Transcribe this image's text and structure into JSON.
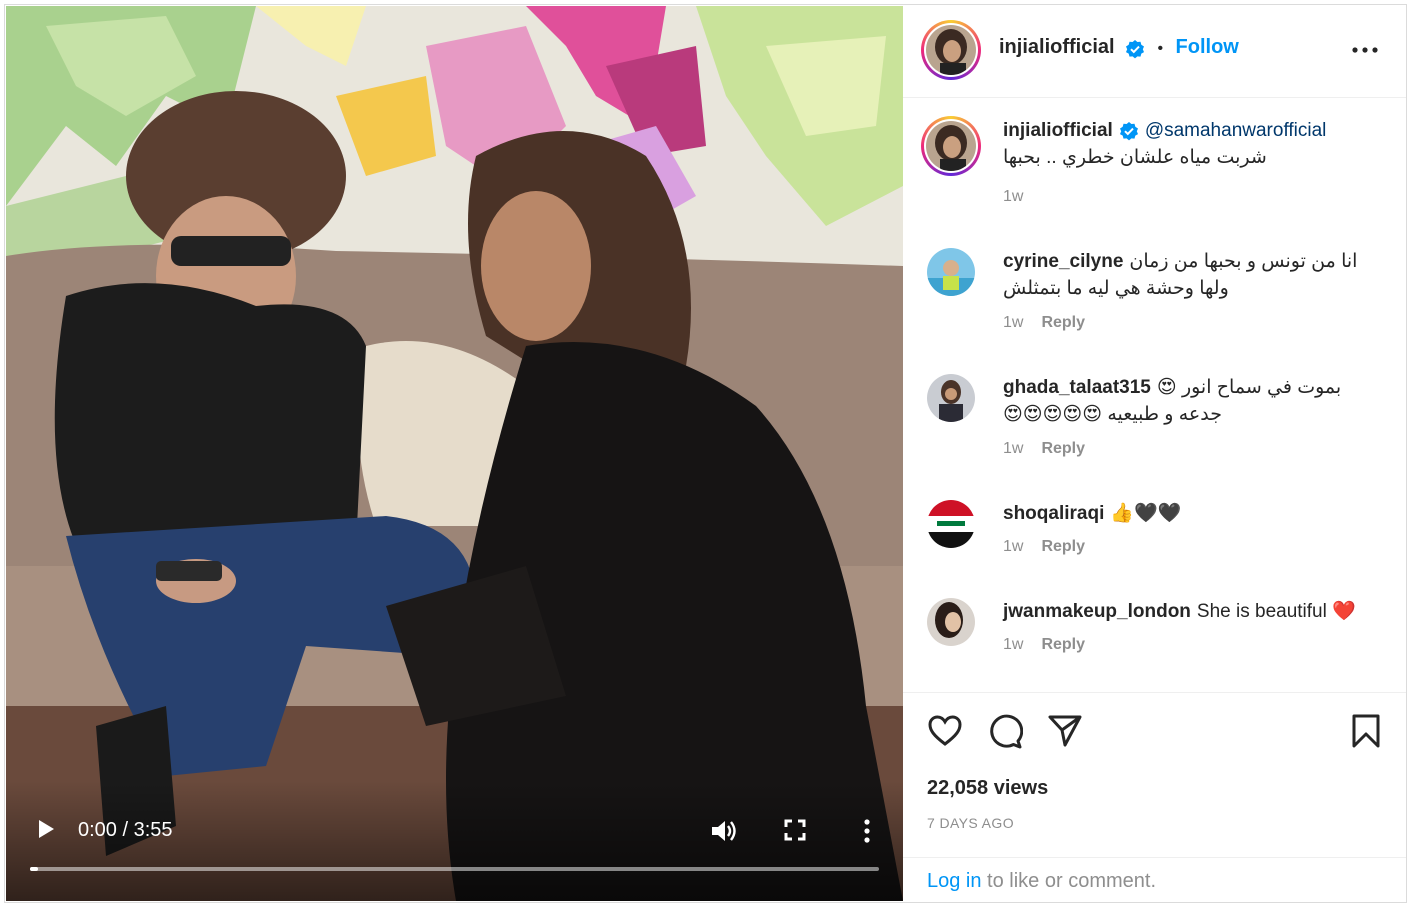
{
  "video": {
    "time_display": "0:00 / 3:55",
    "progress": 0.0
  },
  "post": {
    "author": "injialiofficial",
    "follow_label": "Follow",
    "separator": "•"
  },
  "caption": {
    "username": "injialiofficial",
    "mention": "@samahanwarofficial",
    "text": "شربت مياه علشان خطري .. بحبها",
    "time": "1w"
  },
  "comments": [
    {
      "username": "cyrine_cilyne",
      "text": "انا من تونس و بحبها من زمان ولها وحشة هي ليه ما بتمثلش",
      "time": "1w",
      "reply_label": "Reply"
    },
    {
      "username": "ghada_talaat315",
      "text": "بموت في سماح انور 😍 جدعه و طبيعيه 😍😍😍😍😍",
      "time": "1w",
      "reply_label": "Reply"
    },
    {
      "username": "shoqaliraqi",
      "text": "👍🖤🖤",
      "time": "1w",
      "reply_label": "Reply"
    },
    {
      "username": "jwanmakeup_london",
      "text": "She is beautiful",
      "text_emoji": "❤️",
      "time": "1w",
      "reply_label": "Reply"
    }
  ],
  "stats": {
    "views": "22,058 views",
    "posted_ago": "7 DAYS AGO"
  },
  "login_prompt": {
    "link": "Log in",
    "rest": " to like or comment."
  },
  "colors": {
    "accent_blue": "#0095f6",
    "verified_blue": "#0095f6",
    "muted": "#8e8e8e",
    "text": "#262626"
  },
  "icons": {
    "play": "play-icon",
    "volume": "volume-icon",
    "fullscreen": "fullscreen-icon",
    "more": "more-icon",
    "like": "heart-icon",
    "comment": "comment-icon",
    "share": "share-icon",
    "save": "bookmark-icon",
    "verified": "verified-badge-icon"
  }
}
